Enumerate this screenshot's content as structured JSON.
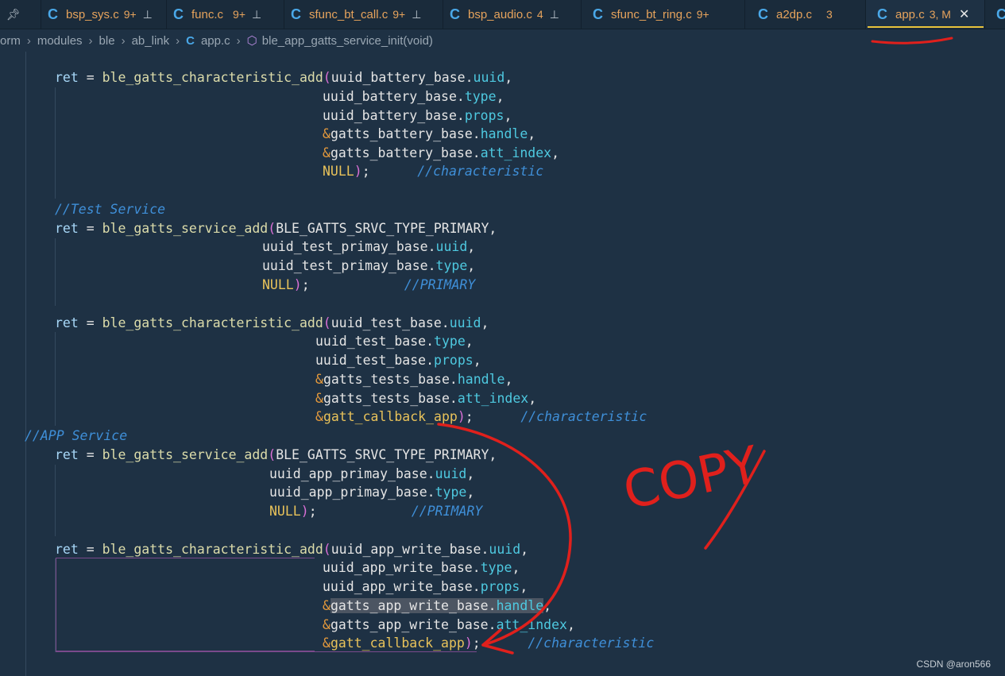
{
  "tabs": [
    {
      "name": "bsp_sys.c",
      "badge": "9+",
      "pinned": true
    },
    {
      "name": "func.c",
      "badge": "9+",
      "pinned": true
    },
    {
      "name": "sfunc_bt_call.c",
      "badge": "9+",
      "pinned": true
    },
    {
      "name": "bsp_audio.c",
      "badge": "4",
      "pinned": true
    },
    {
      "name": "sfunc_bt_ring.c",
      "badge": "9+",
      "pinned": false
    },
    {
      "name": "a2dp.c",
      "badge": "3",
      "pinned": false
    },
    {
      "name": "app.c",
      "badge": "3, M",
      "pinned": false,
      "active": true
    }
  ],
  "breadcrumb": {
    "items": [
      "orm",
      "modules",
      "ble",
      "ab_link",
      "app.c",
      "ble_app_gatts_service_init(void)"
    ]
  },
  "code": {
    "l1": {
      "ret": "ret",
      "eq": " = ",
      "fn": "ble_gatts_characteristic_add",
      "p": "(",
      "a": "uuid_battery_base.",
      "f": "uuid",
      "t": ","
    },
    "l2": {
      "a": "uuid_battery_base.",
      "f": "type",
      "t": ","
    },
    "l3": {
      "a": "uuid_battery_base.",
      "f": "props",
      "t": ","
    },
    "l4": {
      "amp": "&",
      "a": "gatts_battery_base.",
      "f": "handle",
      "t": ","
    },
    "l5": {
      "amp": "&",
      "a": "gatts_battery_base.",
      "f": "att_index",
      "t": ","
    },
    "l6": {
      "n": "NULL",
      "p": ")",
      "t": ";",
      "c": "//characteristic"
    },
    "l7": {
      "c": "//Test Service"
    },
    "l8": {
      "ret": "ret",
      "eq": " = ",
      "fn": "ble_gatts_service_add",
      "p": "(",
      "a": "BLE_GATTS_SRVC_TYPE_PRIMARY",
      "t": ","
    },
    "l9": {
      "a": "uuid_test_primay_base.",
      "f": "uuid",
      "t": ","
    },
    "l10": {
      "a": "uuid_test_primay_base.",
      "f": "type",
      "t": ","
    },
    "l11": {
      "n": "NULL",
      "p": ")",
      "t": ";",
      "c": "//PRIMARY"
    },
    "l12": {
      "ret": "ret",
      "eq": " = ",
      "fn": "ble_gatts_characteristic_add",
      "p": "(",
      "a": "uuid_test_base.",
      "f": "uuid",
      "t": ","
    },
    "l13": {
      "a": "uuid_test_base.",
      "f": "type",
      "t": ","
    },
    "l14": {
      "a": "uuid_test_base.",
      "f": "props",
      "t": ","
    },
    "l15": {
      "amp": "&",
      "a": "gatts_tests_base.",
      "f": "handle",
      "t": ","
    },
    "l16": {
      "amp": "&",
      "a": "gatts_tests_base.",
      "f": "att_index",
      "t": ","
    },
    "l17": {
      "amp": "&",
      "a": "gatt_callback_app",
      "p": ")",
      "t": ";",
      "c": "//characteristic"
    },
    "l18": {
      "c": "//APP Service"
    },
    "l19": {
      "ret": "ret",
      "eq": " = ",
      "fn": "ble_gatts_service_add",
      "p": "(",
      "a": "BLE_GATTS_SRVC_TYPE_PRIMARY",
      "t": ","
    },
    "l20": {
      "a": "uuid_app_primay_base.",
      "f": "uuid",
      "t": ","
    },
    "l21": {
      "a": "uuid_app_primay_base.",
      "f": "type",
      "t": ","
    },
    "l22": {
      "n": "NULL",
      "p": ")",
      "t": ";",
      "c": "//PRIMARY"
    },
    "l23": {
      "ret": "ret",
      "eq": " = ",
      "fn": "ble_gatts_characteristic_add",
      "p": "(",
      "a": "uuid_app_write_base.",
      "f": "uuid",
      "t": ","
    },
    "l24": {
      "a": "uuid_app_write_base.",
      "f": "type",
      "t": ","
    },
    "l25": {
      "a": "uuid_app_write_base.",
      "f": "props",
      "t": ","
    },
    "l26": {
      "amp": "&",
      "a": "gatts_app_write_base.",
      "f": "handle",
      "t": ","
    },
    "l27": {
      "amp": "&",
      "a": "gatts_app_write_base.",
      "f": "att_index",
      "t": ","
    },
    "l28": {
      "amp": "&",
      "a": "gatt_callback_app",
      "p": ")",
      "t": ";",
      "c": "//characteristic"
    }
  },
  "annotation": {
    "text": "COPY",
    "color": "#e0201c"
  },
  "watermark": "CSDN @aron566",
  "colors": {
    "background": "#1e3144",
    "tab_active_underline": "#e8c23a",
    "icon_c": "#4aa8e8"
  }
}
